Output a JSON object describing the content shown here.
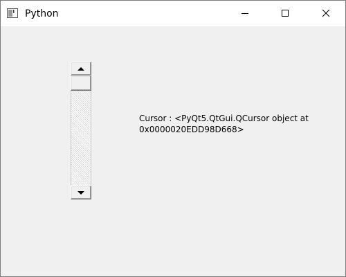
{
  "window": {
    "title": "Python",
    "icon": "python-window-icon",
    "controls": {
      "minimize": "minimize-icon",
      "maximize": "maximize-icon",
      "close": "close-icon"
    }
  },
  "content": {
    "cursor_text": "Cursor : <PyQt5.QtGui.QCursor object at\n0x0000020EDD98D668>"
  },
  "scrollbar": {
    "orientation": "vertical",
    "value_fraction": 0
  }
}
